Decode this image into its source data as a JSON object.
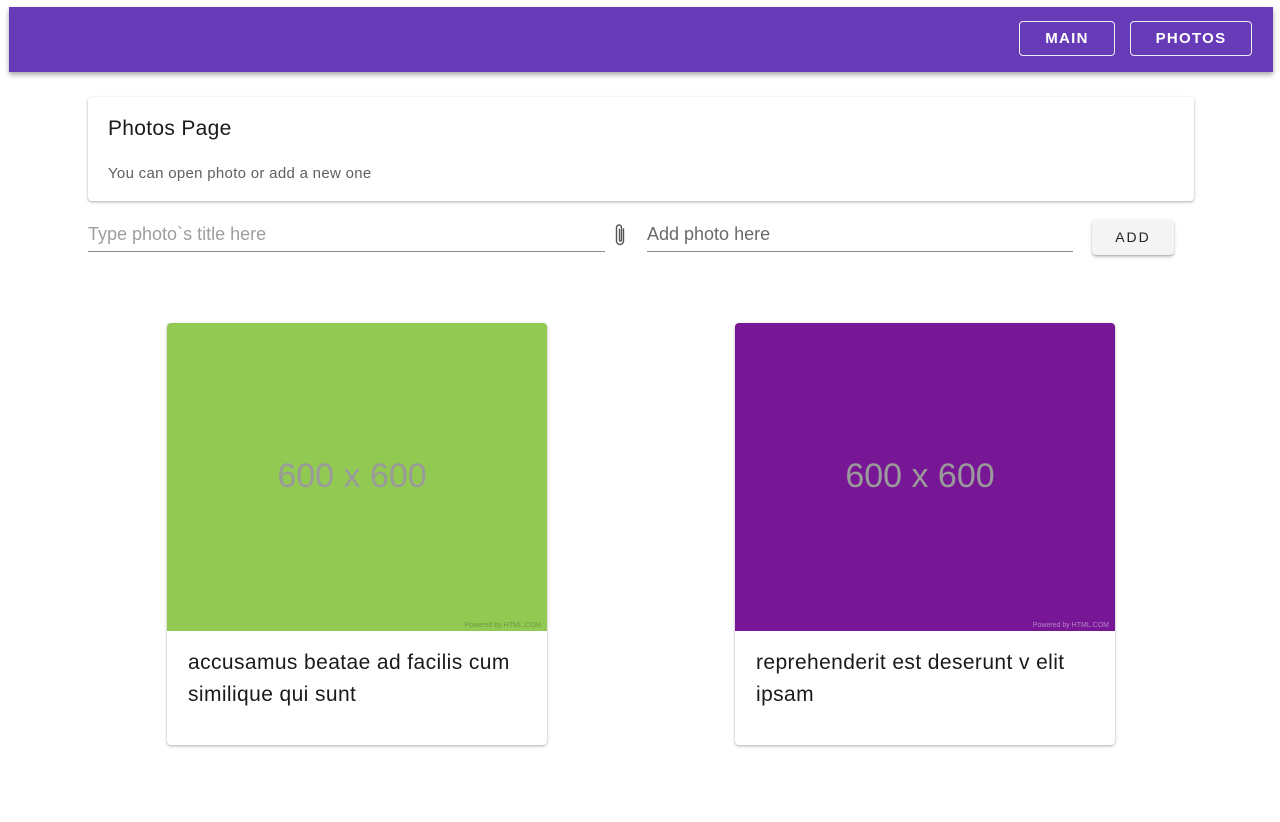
{
  "nav": {
    "main_label": "MAIN",
    "photos_label": "PHOTOS",
    "color": "#673ab7"
  },
  "header": {
    "title": "Photos Page",
    "subtitle": "You can open photo or add a new one"
  },
  "form": {
    "title_placeholder": "Type photo`s title here",
    "photo_placeholder": "Add photo here",
    "attach_icon": "paperclip-icon",
    "add_label": "ADD"
  },
  "photos": [
    {
      "size_text": "600 x 600",
      "credit": "Powered by HTML.COM",
      "title": "accusamus beatae ad facilis cum similique qui sunt",
      "color": "#92c952"
    },
    {
      "size_text": "600 x 600",
      "credit": "Powered by HTML.COM",
      "title": "reprehenderit est deserunt v elit ipsam",
      "color": "#771796"
    }
  ]
}
